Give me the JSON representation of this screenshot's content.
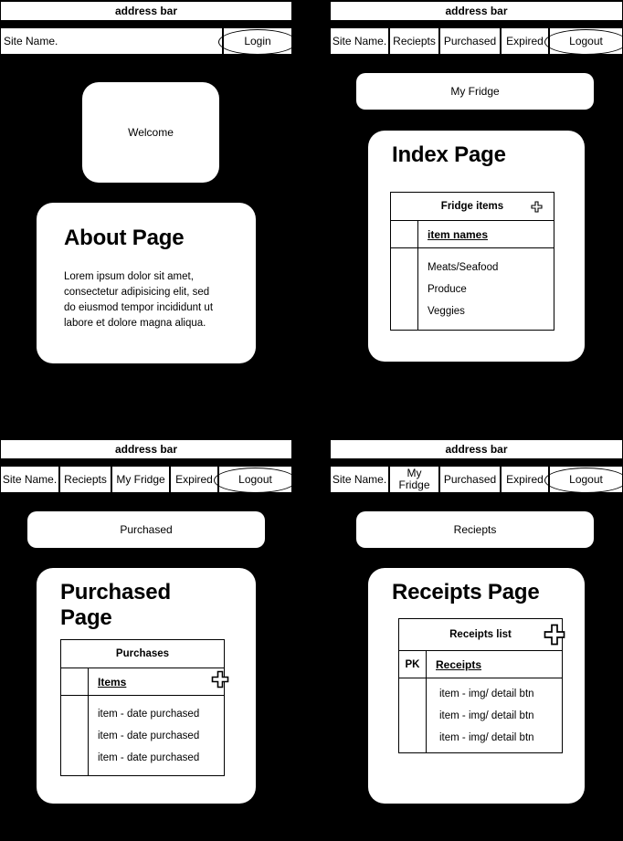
{
  "panels": {
    "login": {
      "address_bar": "address bar",
      "nav": [
        {
          "label": "Site Name.",
          "shape": "cell",
          "align": "left"
        },
        {
          "label": "Login",
          "shape": "ellipse",
          "align": "center"
        }
      ],
      "welcome_card": {
        "label": "Welcome"
      },
      "about_card": {
        "title": "About Page",
        "body": "Lorem ipsum dolor sit amet, consectetur adipisicing elit, sed do eiusmod tempor incididunt ut labore et dolore magna aliqua."
      }
    },
    "index": {
      "address_bar": "address bar",
      "nav": [
        {
          "label": "Site Name.",
          "shape": "cell"
        },
        {
          "label": "Reciepts",
          "shape": "cell"
        },
        {
          "label": "Purchased",
          "shape": "cell"
        },
        {
          "label": "Expired",
          "shape": "cell"
        },
        {
          "label": "Logout",
          "shape": "ellipse"
        }
      ],
      "page_button": "My Fridge",
      "card": {
        "title": "Index Page",
        "table": {
          "header": "Fridge items",
          "add_icon": "plus-icon",
          "key_column": "",
          "column_header": "item names",
          "rows": [
            "Meats/Seafood",
            "Produce",
            "Veggies"
          ]
        }
      }
    },
    "purchased": {
      "address_bar": "address bar",
      "nav": [
        {
          "label": "Site Name.",
          "shape": "cell"
        },
        {
          "label": "Reciepts",
          "shape": "cell"
        },
        {
          "label": "My Fridge",
          "shape": "cell"
        },
        {
          "label": "Expired",
          "shape": "cell"
        },
        {
          "label": "Logout",
          "shape": "ellipse"
        }
      ],
      "page_button": "Purchased",
      "card": {
        "title": "Purchased Page",
        "table": {
          "header": "Purchases",
          "add_icon": "plus-icon",
          "key_column": "",
          "column_header": "Items",
          "rows": [
            "item - date purchased",
            "item - date purchased",
            "item - date purchased"
          ]
        }
      }
    },
    "receipts": {
      "address_bar": "address bar",
      "nav": [
        {
          "label": "Site Name.",
          "shape": "cell"
        },
        {
          "label": "My\nFridge",
          "shape": "cell"
        },
        {
          "label": "Purchased",
          "shape": "cell"
        },
        {
          "label": "Expired",
          "shape": "cell"
        },
        {
          "label": "Logout",
          "shape": "ellipse"
        }
      ],
      "page_button": "Reciepts",
      "card": {
        "title": "Receipts Page",
        "table": {
          "header": "Receipts list",
          "add_icon": "plus-icon",
          "key_column": "PK",
          "column_header": "Receipts",
          "rows": [
            "item - img/ detail btn",
            "item - img/ detail btn",
            "item - img/ detail btn"
          ]
        }
      }
    }
  },
  "colors": {
    "background": "#000000",
    "surface": "#ffffff",
    "stroke": "#000000"
  }
}
